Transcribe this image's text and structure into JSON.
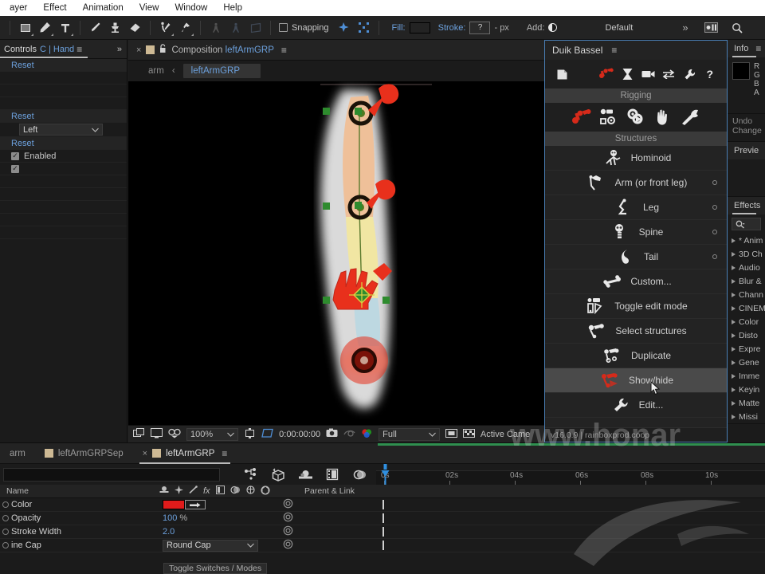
{
  "menubar": {
    "items": [
      "ayer",
      "Effect",
      "Animation",
      "View",
      "Window",
      "Help"
    ]
  },
  "toolbar": {
    "snapping_label": "Snapping",
    "fill_label": "Fill:",
    "fill_color": "#ff2d16",
    "stroke_label": "Stroke:",
    "stroke_value": "?",
    "stroke_units": "- px",
    "add_label": "Add:",
    "workspace": "Default",
    "overflow": "»"
  },
  "left_panel": {
    "tab_label": "Controls",
    "tab_label_2": "C | Hand",
    "overflow": "»",
    "rows": [
      {
        "type": "reset",
        "label": "Reset"
      },
      {
        "type": "blank",
        "label": ""
      },
      {
        "type": "blank",
        "label": ""
      },
      {
        "type": "reset",
        "label": "Reset"
      },
      {
        "type": "select",
        "label": "Left"
      },
      {
        "type": "reset",
        "label": "Reset"
      },
      {
        "type": "check",
        "label": "Enabled"
      },
      {
        "type": "check",
        "label": ""
      }
    ]
  },
  "composition": {
    "tab_prefix": "Composition",
    "tab_name": "leftArmGRP",
    "breadcrumb_root": "arm",
    "breadcrumb_sep": "‹",
    "breadcrumb_current": "leftArmGRP",
    "zoom": "100%",
    "timecode": "0:00:00:00",
    "resolution": "Full",
    "camera": "Active Came"
  },
  "duik": {
    "title": "Duik Bassel",
    "menu_icon": "≡",
    "section_rigging": "Rigging",
    "section_structures": "Structures",
    "version": "v16.0.9 | rainboxprod.coop",
    "top_icons": [
      "file-icon",
      "rigging-icon",
      "automation-icon",
      "camera-icon",
      "swap-icon",
      "wrench-icon",
      "help-icon"
    ],
    "rig_icons": [
      "armature-icon",
      "links-icon",
      "automation-gear-icon",
      "hand-icon",
      "tools-icon"
    ],
    "items": [
      {
        "label": "Hominoid",
        "icon": "hominoid-icon",
        "dot": false,
        "highlight": false
      },
      {
        "label": "Arm (or front leg)",
        "icon": "arm-icon",
        "dot": true,
        "highlight": false
      },
      {
        "label": "Leg",
        "icon": "leg-icon",
        "dot": true,
        "highlight": false
      },
      {
        "label": "Spine",
        "icon": "spine-icon",
        "dot": true,
        "highlight": false
      },
      {
        "label": "Tail",
        "icon": "tail-icon",
        "dot": true,
        "highlight": false
      },
      {
        "label": "Custom...",
        "icon": "bone-icon",
        "dot": false,
        "highlight": false
      },
      {
        "label": "Toggle edit mode",
        "icon": "edit-mode-icon",
        "dot": false,
        "highlight": false
      },
      {
        "label": "Select structures",
        "icon": "select-icon",
        "dot": false,
        "highlight": false
      },
      {
        "label": "Duplicate",
        "icon": "duplicate-icon",
        "dot": false,
        "highlight": false
      },
      {
        "label": "Show/hide",
        "icon": "show-hide-icon",
        "dot": false,
        "highlight": true
      },
      {
        "label": "Edit...",
        "icon": "wrench-icon",
        "dot": false,
        "highlight": false
      }
    ]
  },
  "rail": {
    "info_tab": "Info",
    "info_channels": [
      "R",
      "G",
      "B",
      "A"
    ],
    "undo_line1": "Undo",
    "undo_line2": "Change",
    "preview_tab": "Previe",
    "effects_tab": "Effects",
    "effects_items": [
      "* Anim",
      "3D Ch",
      "Audio",
      "Blur &",
      "Chann",
      "CINEM",
      "Color",
      "Disto",
      "Expre",
      "Gene",
      "Imme",
      "Keyin",
      "Matte",
      "Missi"
    ]
  },
  "timeline": {
    "tabs": [
      {
        "label": "arm",
        "active": false,
        "closable": false
      },
      {
        "label": "leftArmGRPSep",
        "active": false,
        "closable": false
      },
      {
        "label": "leftArmGRP",
        "active": true,
        "closable": true
      }
    ],
    "column_name": "Name",
    "column_parent": "Parent & Link",
    "toggle_switches": "Toggle Switches / Modes",
    "ruler_ticks": [
      "0s",
      "02s",
      "04s",
      "06s",
      "08s",
      "10s"
    ],
    "properties": [
      {
        "name": "Color",
        "value": "",
        "unit": "",
        "kind": "color"
      },
      {
        "name": "Opacity",
        "value": "100",
        "unit": "%",
        "kind": "number"
      },
      {
        "name": "Stroke Width",
        "value": "2.0",
        "unit": "",
        "kind": "number"
      },
      {
        "name": "ine Cap",
        "value": "Round Cap",
        "unit": "",
        "kind": "select"
      }
    ]
  },
  "watermark": {
    "text": "www.honar"
  }
}
